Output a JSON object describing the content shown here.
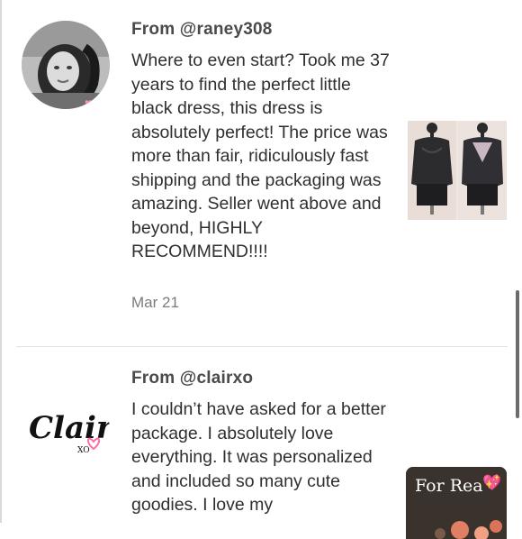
{
  "reviews": [
    {
      "from": "From @raney308",
      "avatar_icon": "user-photo-avatar",
      "text": "Where to even start? Took me 37 years to find the perfect little black dress, this dress is absolutely perfect! The price was more than fair, ridiculously fast shipping and the packaging was amazing. Seller went above and beyond, HIGHLY RECOMMEND!!!!",
      "date": "Mar 21",
      "photo_icon": "black-dress-photo"
    },
    {
      "from": "From @clairxo",
      "avatar_icon": "clair-xo-logo",
      "avatar_logo_text": "Clair",
      "avatar_logo_sub": "XO",
      "text": "I couldn’t have asked for a better package. I absolutely love everything. It was personalized and included so many cute goodies. I love my",
      "photo_caption": "For Rea",
      "photo_icon": "package-photo"
    }
  ],
  "colors": {
    "accent_pink": "#ff6fa8",
    "text": "#2f2f2f",
    "muted": "#7b7b7b"
  }
}
